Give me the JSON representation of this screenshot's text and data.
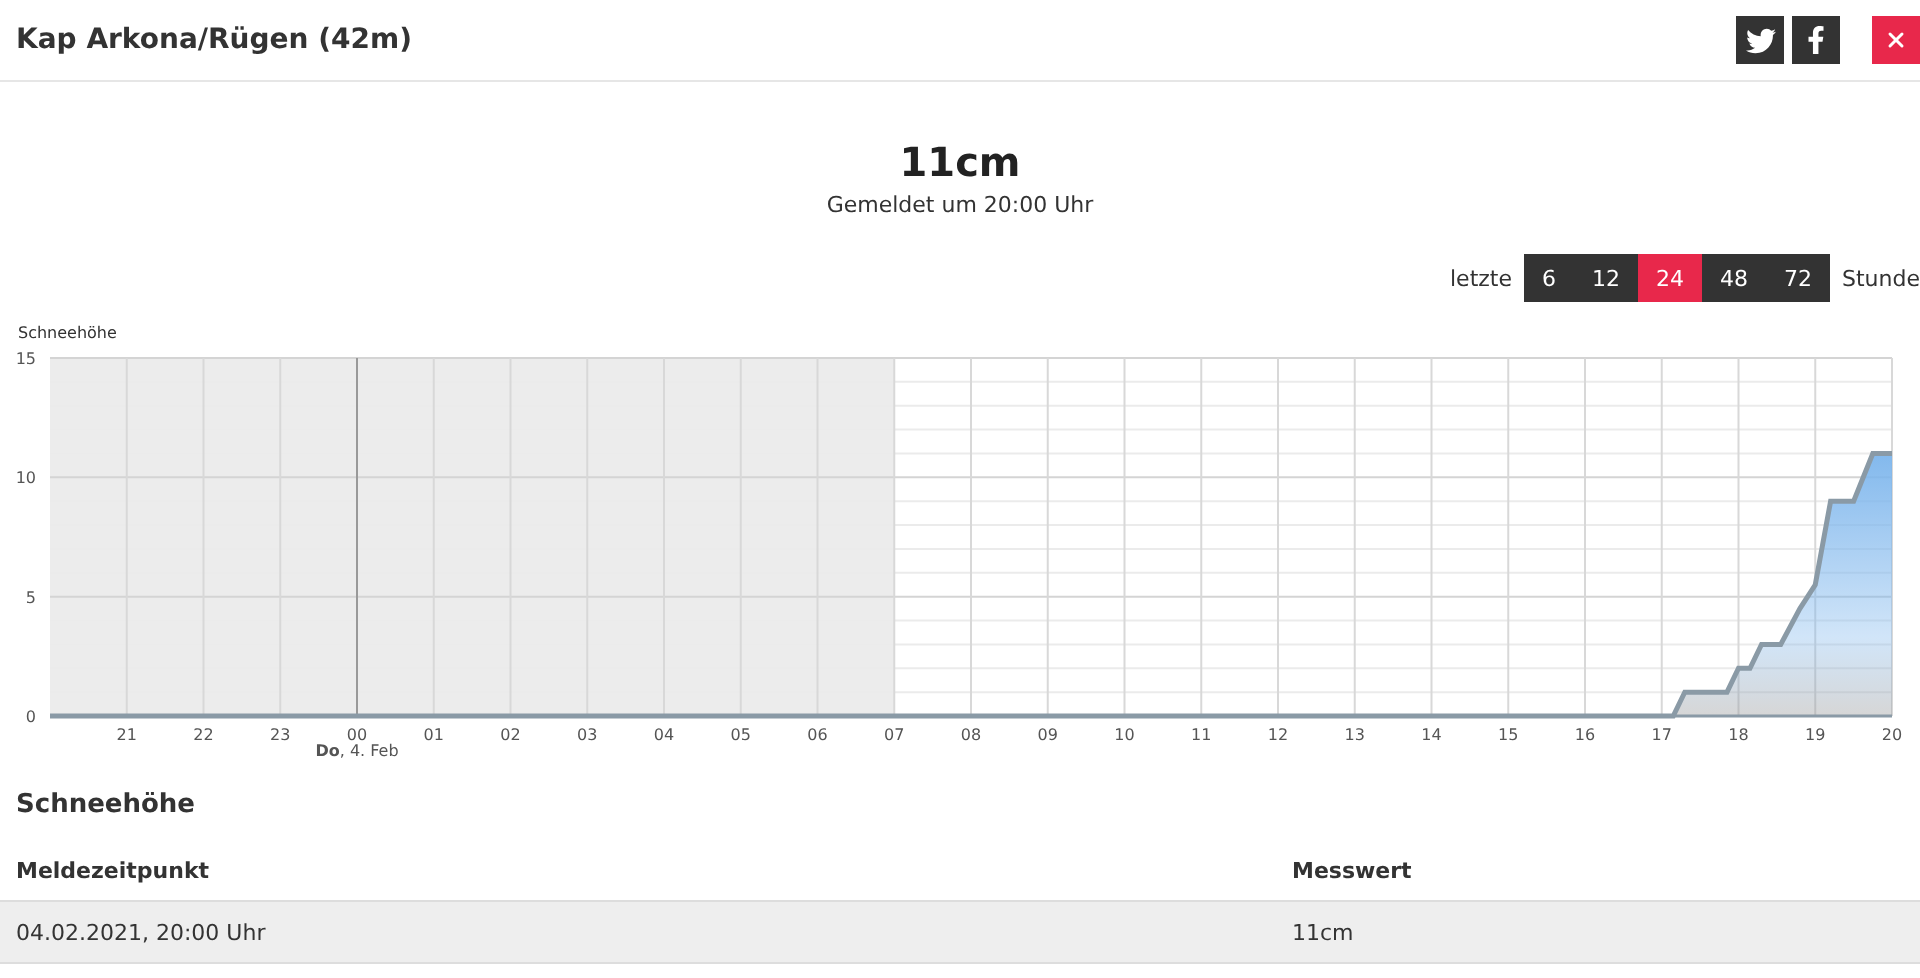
{
  "window": {
    "title": "Kap Arkona/Rügen (42m)"
  },
  "summary": {
    "value": "11cm",
    "subtitle": "Gemeldet um 20:00 Uhr"
  },
  "range": {
    "prefix": "letzte",
    "suffix": "Stunde",
    "options": [
      {
        "label": "6",
        "selected": false
      },
      {
        "label": "12",
        "selected": false
      },
      {
        "label": "24",
        "selected": true
      },
      {
        "label": "48",
        "selected": false
      },
      {
        "label": "72",
        "selected": false
      }
    ]
  },
  "chart": {
    "previous_day_ticks": [
      "21",
      "22",
      "23"
    ],
    "chart_data": {
      "type": "area",
      "ylabel": "Schneehöhe",
      "xlim": [
        -4,
        20
      ],
      "ylim": [
        0,
        15
      ],
      "yticks": [
        0,
        5,
        10,
        15
      ],
      "xticks": [
        {
          "value": 0,
          "label": "00"
        },
        {
          "value": 1,
          "label": "01"
        },
        {
          "value": 2,
          "label": "02"
        },
        {
          "value": 3,
          "label": "03"
        },
        {
          "value": 4,
          "label": "04"
        },
        {
          "value": 5,
          "label": "05"
        },
        {
          "value": 6,
          "label": "06"
        },
        {
          "value": 7,
          "label": "07"
        },
        {
          "value": 8,
          "label": "08"
        },
        {
          "value": 9,
          "label": "09"
        },
        10,
        11,
        12,
        13,
        14,
        15,
        16,
        17,
        18,
        19,
        20
      ],
      "x": [
        -4,
        17.15,
        17.3,
        17.85,
        18.0,
        18.15,
        18.3,
        18.55,
        18.8,
        19.0,
        19.2,
        19.5,
        19.75,
        20
      ],
      "series": [
        {
          "color": "#7cb5ec",
          "values": [
            0,
            0,
            1,
            1,
            2,
            2,
            3,
            3,
            4.5,
            5.5,
            9,
            9,
            11,
            11
          ]
        }
      ],
      "grid": true,
      "bands": [
        {
          "axis": "x",
          "from": -4,
          "to": 7,
          "color": "#ececec"
        }
      ]
    },
    "date_label": "**Do**, 4. Feb"
  },
  "table": {
    "title": "Schneehöhe",
    "columns": [
      "Meldezeitpunkt",
      "Messwert"
    ],
    "rows": [
      [
        "04.02.2021, 20:00 Uhr",
        "11cm"
      ]
    ]
  }
}
